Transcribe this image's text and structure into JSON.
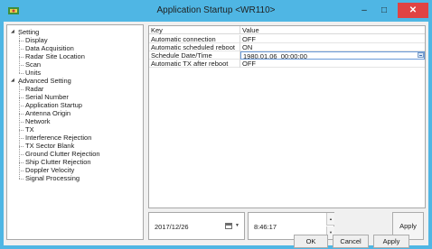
{
  "window": {
    "title": "Application Startup <WR110>",
    "minimize_glyph": "–",
    "maximize_glyph": "□",
    "close_glyph": "✕"
  },
  "tree": {
    "groups": [
      {
        "label": "Setting",
        "items": [
          "Display",
          "Data Acquisition",
          "Radar Site Location",
          "Scan",
          "Units"
        ]
      },
      {
        "label": "Advanced Setting",
        "items": [
          "Radar",
          "Serial Number",
          "Application Startup",
          "Antenna Origin",
          "Network",
          "TX",
          "Interference Rejection",
          "TX Sector Blank",
          "Ground Clutter Rejection",
          "Ship Clutter Rejection",
          "Doppler Velocity",
          "Signal Processing"
        ]
      }
    ],
    "selected": "Application Startup"
  },
  "grid": {
    "headers": {
      "key": "Key",
      "value": "Value"
    },
    "rows": [
      {
        "key": "Automatic connection",
        "value": "OFF"
      },
      {
        "key": "Automatic scheduled reboot",
        "value": "ON"
      },
      {
        "key": "Schedule Date/Time",
        "value": "1980.01.06_00:00:00"
      },
      {
        "key": "Automatic TX after reboot",
        "value": "OFF"
      }
    ],
    "active_row": 2
  },
  "datetime": {
    "date": "2017/12/26",
    "time": "8:46:17",
    "apply_label": "Apply"
  },
  "footer": {
    "ok_label": "OK",
    "cancel_label": "Cancel",
    "apply_label": "Apply"
  },
  "icons": {
    "app": "app-icon",
    "expand": "expanded-triangle-icon",
    "calendar": "calendar-icon"
  },
  "colors": {
    "titlebar": "#4fb6e4",
    "close": "#e04343",
    "panel": "#f0f0f0"
  }
}
